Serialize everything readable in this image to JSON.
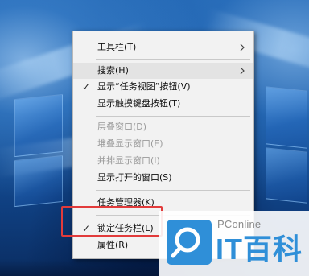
{
  "menu": {
    "items": [
      {
        "label": "工具栏(T)",
        "has_submenu": true,
        "checked": false,
        "disabled": false
      },
      {
        "label": "搜索(H)",
        "has_submenu": true,
        "checked": false,
        "disabled": false
      },
      {
        "label": "显示“任务视图”按钮(V)",
        "has_submenu": false,
        "checked": true,
        "disabled": false
      },
      {
        "label": "显示触摸键盘按钮(T)",
        "has_submenu": false,
        "checked": false,
        "disabled": false
      },
      {
        "label": "层叠窗口(D)",
        "has_submenu": false,
        "checked": false,
        "disabled": true
      },
      {
        "label": "堆叠显示窗口(E)",
        "has_submenu": false,
        "checked": false,
        "disabled": true
      },
      {
        "label": "并排显示窗口(I)",
        "has_submenu": false,
        "checked": false,
        "disabled": true
      },
      {
        "label": "显示打开的窗口(S)",
        "has_submenu": false,
        "checked": false,
        "disabled": false
      },
      {
        "label": "任务管理器(K)",
        "has_submenu": false,
        "checked": false,
        "disabled": false
      },
      {
        "label": "锁定任务栏(L)",
        "has_submenu": false,
        "checked": true,
        "disabled": false,
        "highlighted": true
      },
      {
        "label": "属性(R)",
        "has_submenu": false,
        "checked": false,
        "disabled": false
      }
    ]
  },
  "icons": {
    "check": "✓",
    "submenu_arrow": "chevron-right-icon"
  },
  "watermark": {
    "brand": "PConline",
    "title": "IT百科",
    "accent_color": "#2f8fd8"
  },
  "colors": {
    "highlight_box": "#e23b3b",
    "menu_background": "#f2f2f2",
    "disabled_text": "#9a9a9a"
  }
}
